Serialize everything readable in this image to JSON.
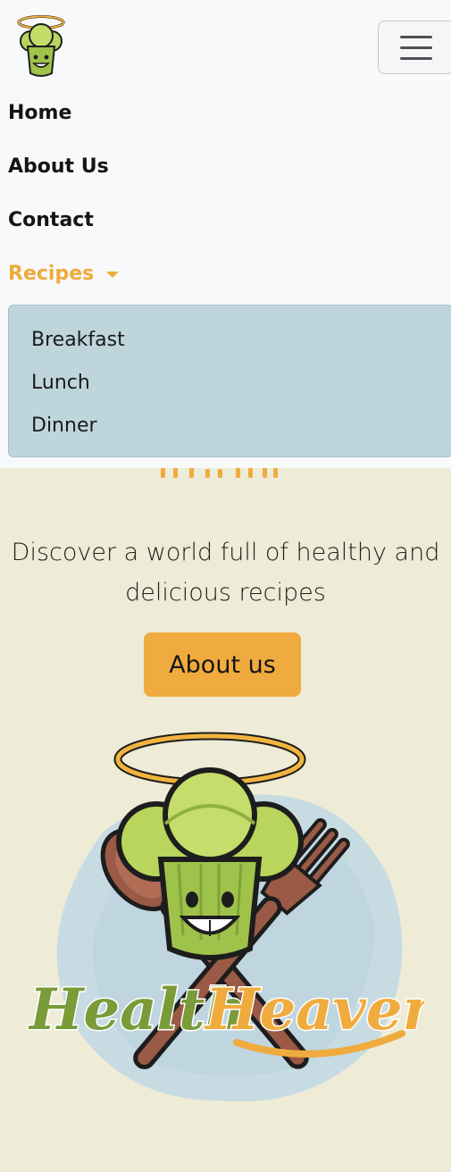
{
  "navbar": {
    "brand_logo_icon": "chef-broccoli-halo-logo",
    "toggler_icon": "hamburger-menu-icon",
    "links": {
      "home": "Home",
      "about": "About Us",
      "contact": "Contact",
      "recipes": "Recipes"
    },
    "active_color": "#efaa3c",
    "dropdown": {
      "items": [
        "Breakfast",
        "Lunch",
        "Dinner"
      ],
      "background": "#bed5dc"
    }
  },
  "hero": {
    "tagline": "Discover a world full of healthy and delicious recipes",
    "cta_label": "About us",
    "cta_color": "#f0ab3e",
    "logo_text_left": "Health",
    "logo_text_right": "Heaven",
    "logo_icon": "chef-broccoli-spoon-fork-logo"
  },
  "colors": {
    "page_background": "#eeebd6",
    "navbar_background": "#f8f9fb"
  }
}
